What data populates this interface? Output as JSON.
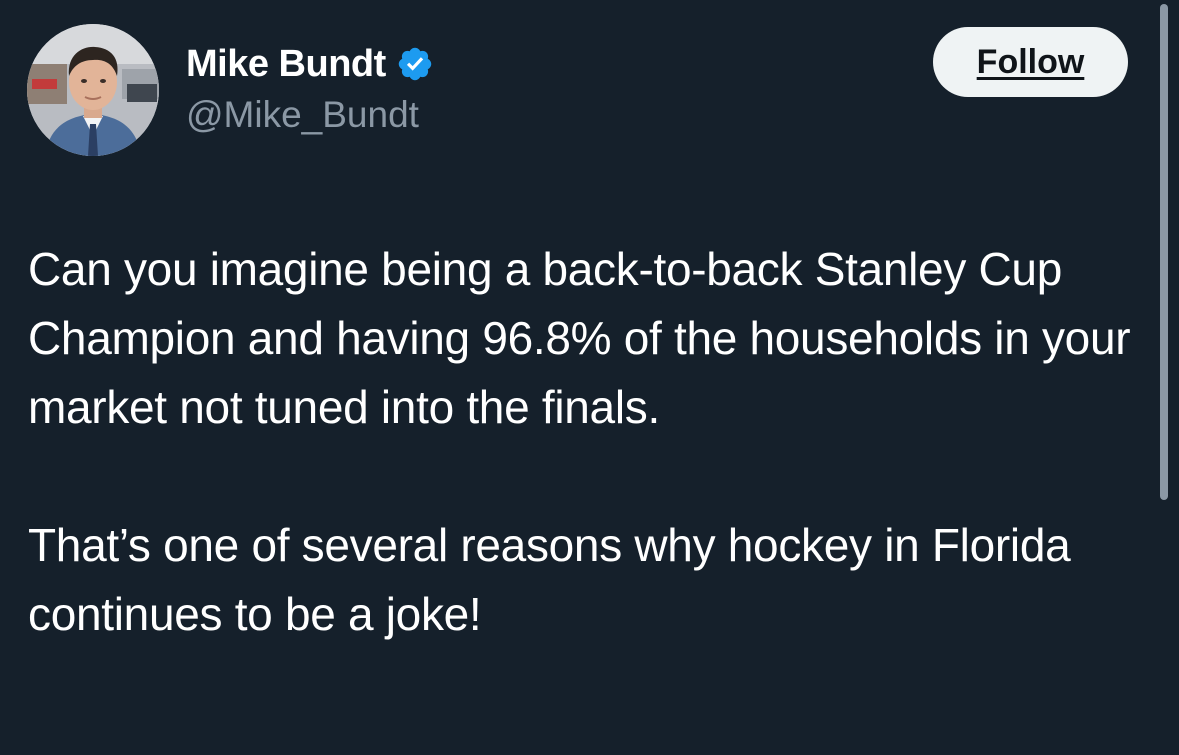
{
  "author": {
    "display_name": "Mike Bundt",
    "handle": "@Mike_Bundt",
    "verified": true,
    "avatar_icon": "profile-photo"
  },
  "follow_button": {
    "label": "Follow"
  },
  "tweet": {
    "paragraphs": [
      "Can you imagine being a back-to-back Stanley Cup Champion and having 96.8% of the households in your market not tuned into the finals.",
      "That’s one of several reasons why hockey in Florida continues to be a joke!"
    ]
  },
  "colors": {
    "background": "#15202b",
    "text_primary": "#ffffff",
    "text_secondary": "#8b98a5",
    "verified_badge": "#1d9bf0",
    "follow_button_bg": "#eff3f4",
    "follow_button_text": "#0f1419"
  }
}
